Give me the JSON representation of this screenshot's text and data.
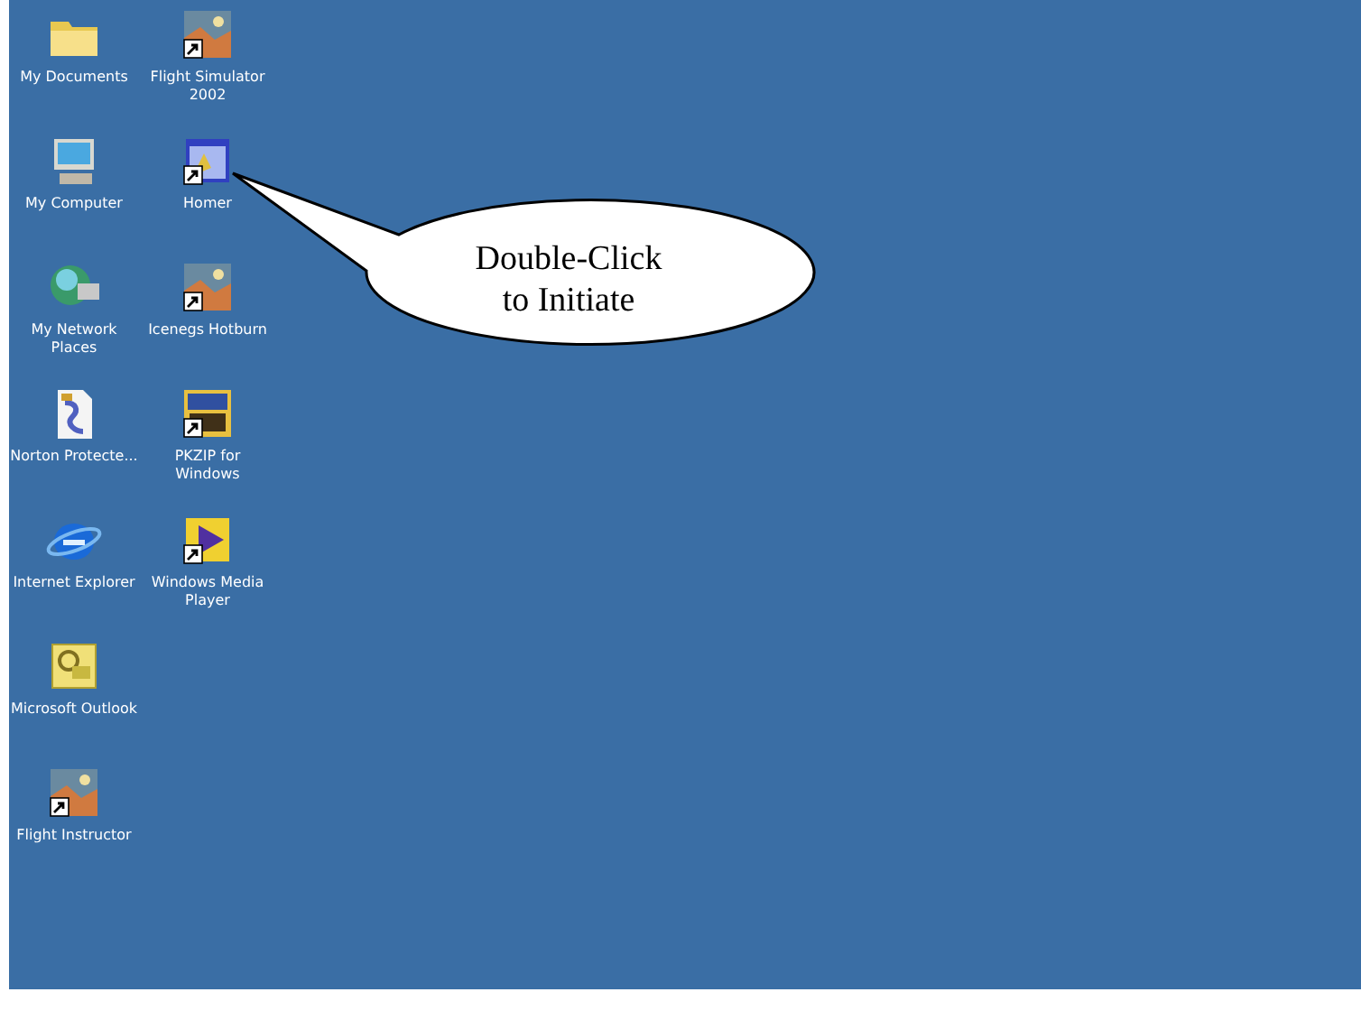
{
  "desktop": {
    "columns": [
      {
        "icons": [
          {
            "kind": "folder",
            "label": "My Documents",
            "shortcut": false
          },
          {
            "kind": "computer",
            "label": "My Computer",
            "shortcut": false
          },
          {
            "kind": "network",
            "label": "My Network Places",
            "shortcut": false
          },
          {
            "kind": "document",
            "label": "Norton Protecte...",
            "shortcut": false
          },
          {
            "kind": "globe",
            "label": "Internet Explorer",
            "shortcut": false
          },
          {
            "kind": "envelope",
            "label": "Microsoft Outlook",
            "shortcut": false
          },
          {
            "kind": "photo",
            "label": "Flight Instructor",
            "shortcut": true
          }
        ]
      },
      {
        "icons": [
          {
            "kind": "photo",
            "label": "Flight Simulator 2002",
            "shortcut": true
          },
          {
            "kind": "window",
            "label": "Homer",
            "shortcut": true
          },
          {
            "kind": "photo",
            "label": "Icenegs Hotburn",
            "shortcut": true
          },
          {
            "kind": "archive",
            "label": "PKZIP for Windows",
            "shortcut": true
          },
          {
            "kind": "play",
            "label": "Windows Media Player",
            "shortcut": true
          }
        ]
      }
    ]
  },
  "callout": {
    "lines": [
      "Double-Click",
      "to Initiate"
    ]
  }
}
